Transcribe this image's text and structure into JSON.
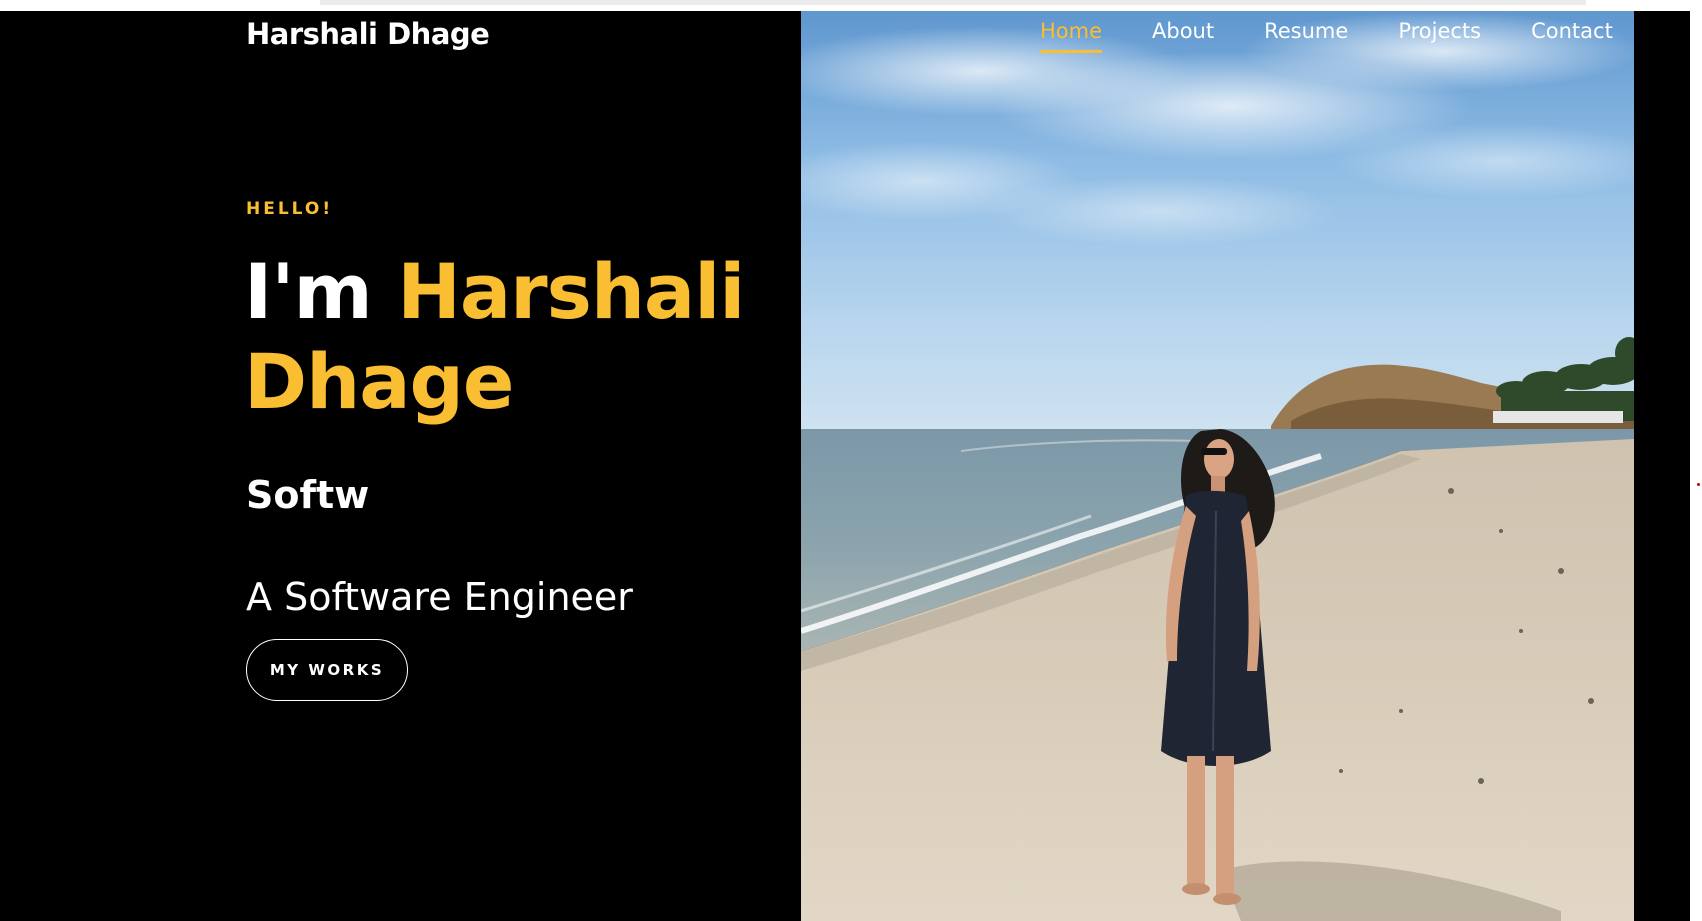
{
  "brand": {
    "name": "Harshali Dhage"
  },
  "nav": {
    "items": [
      {
        "label": "Home",
        "active": true
      },
      {
        "label": "About"
      },
      {
        "label": "Resume"
      },
      {
        "label": "Projects"
      },
      {
        "label": "Contact"
      }
    ]
  },
  "hero": {
    "greeting": "HELLO!",
    "intro": "I'm",
    "name_first": "Harshali",
    "name_last": "Dhage",
    "typed_text": "Softw",
    "subtitle": "A Software Engineer",
    "cta_label": "MY WORKS"
  },
  "colors": {
    "accent": "#f9be32",
    "background": "#000000",
    "text": "#ffffff"
  }
}
